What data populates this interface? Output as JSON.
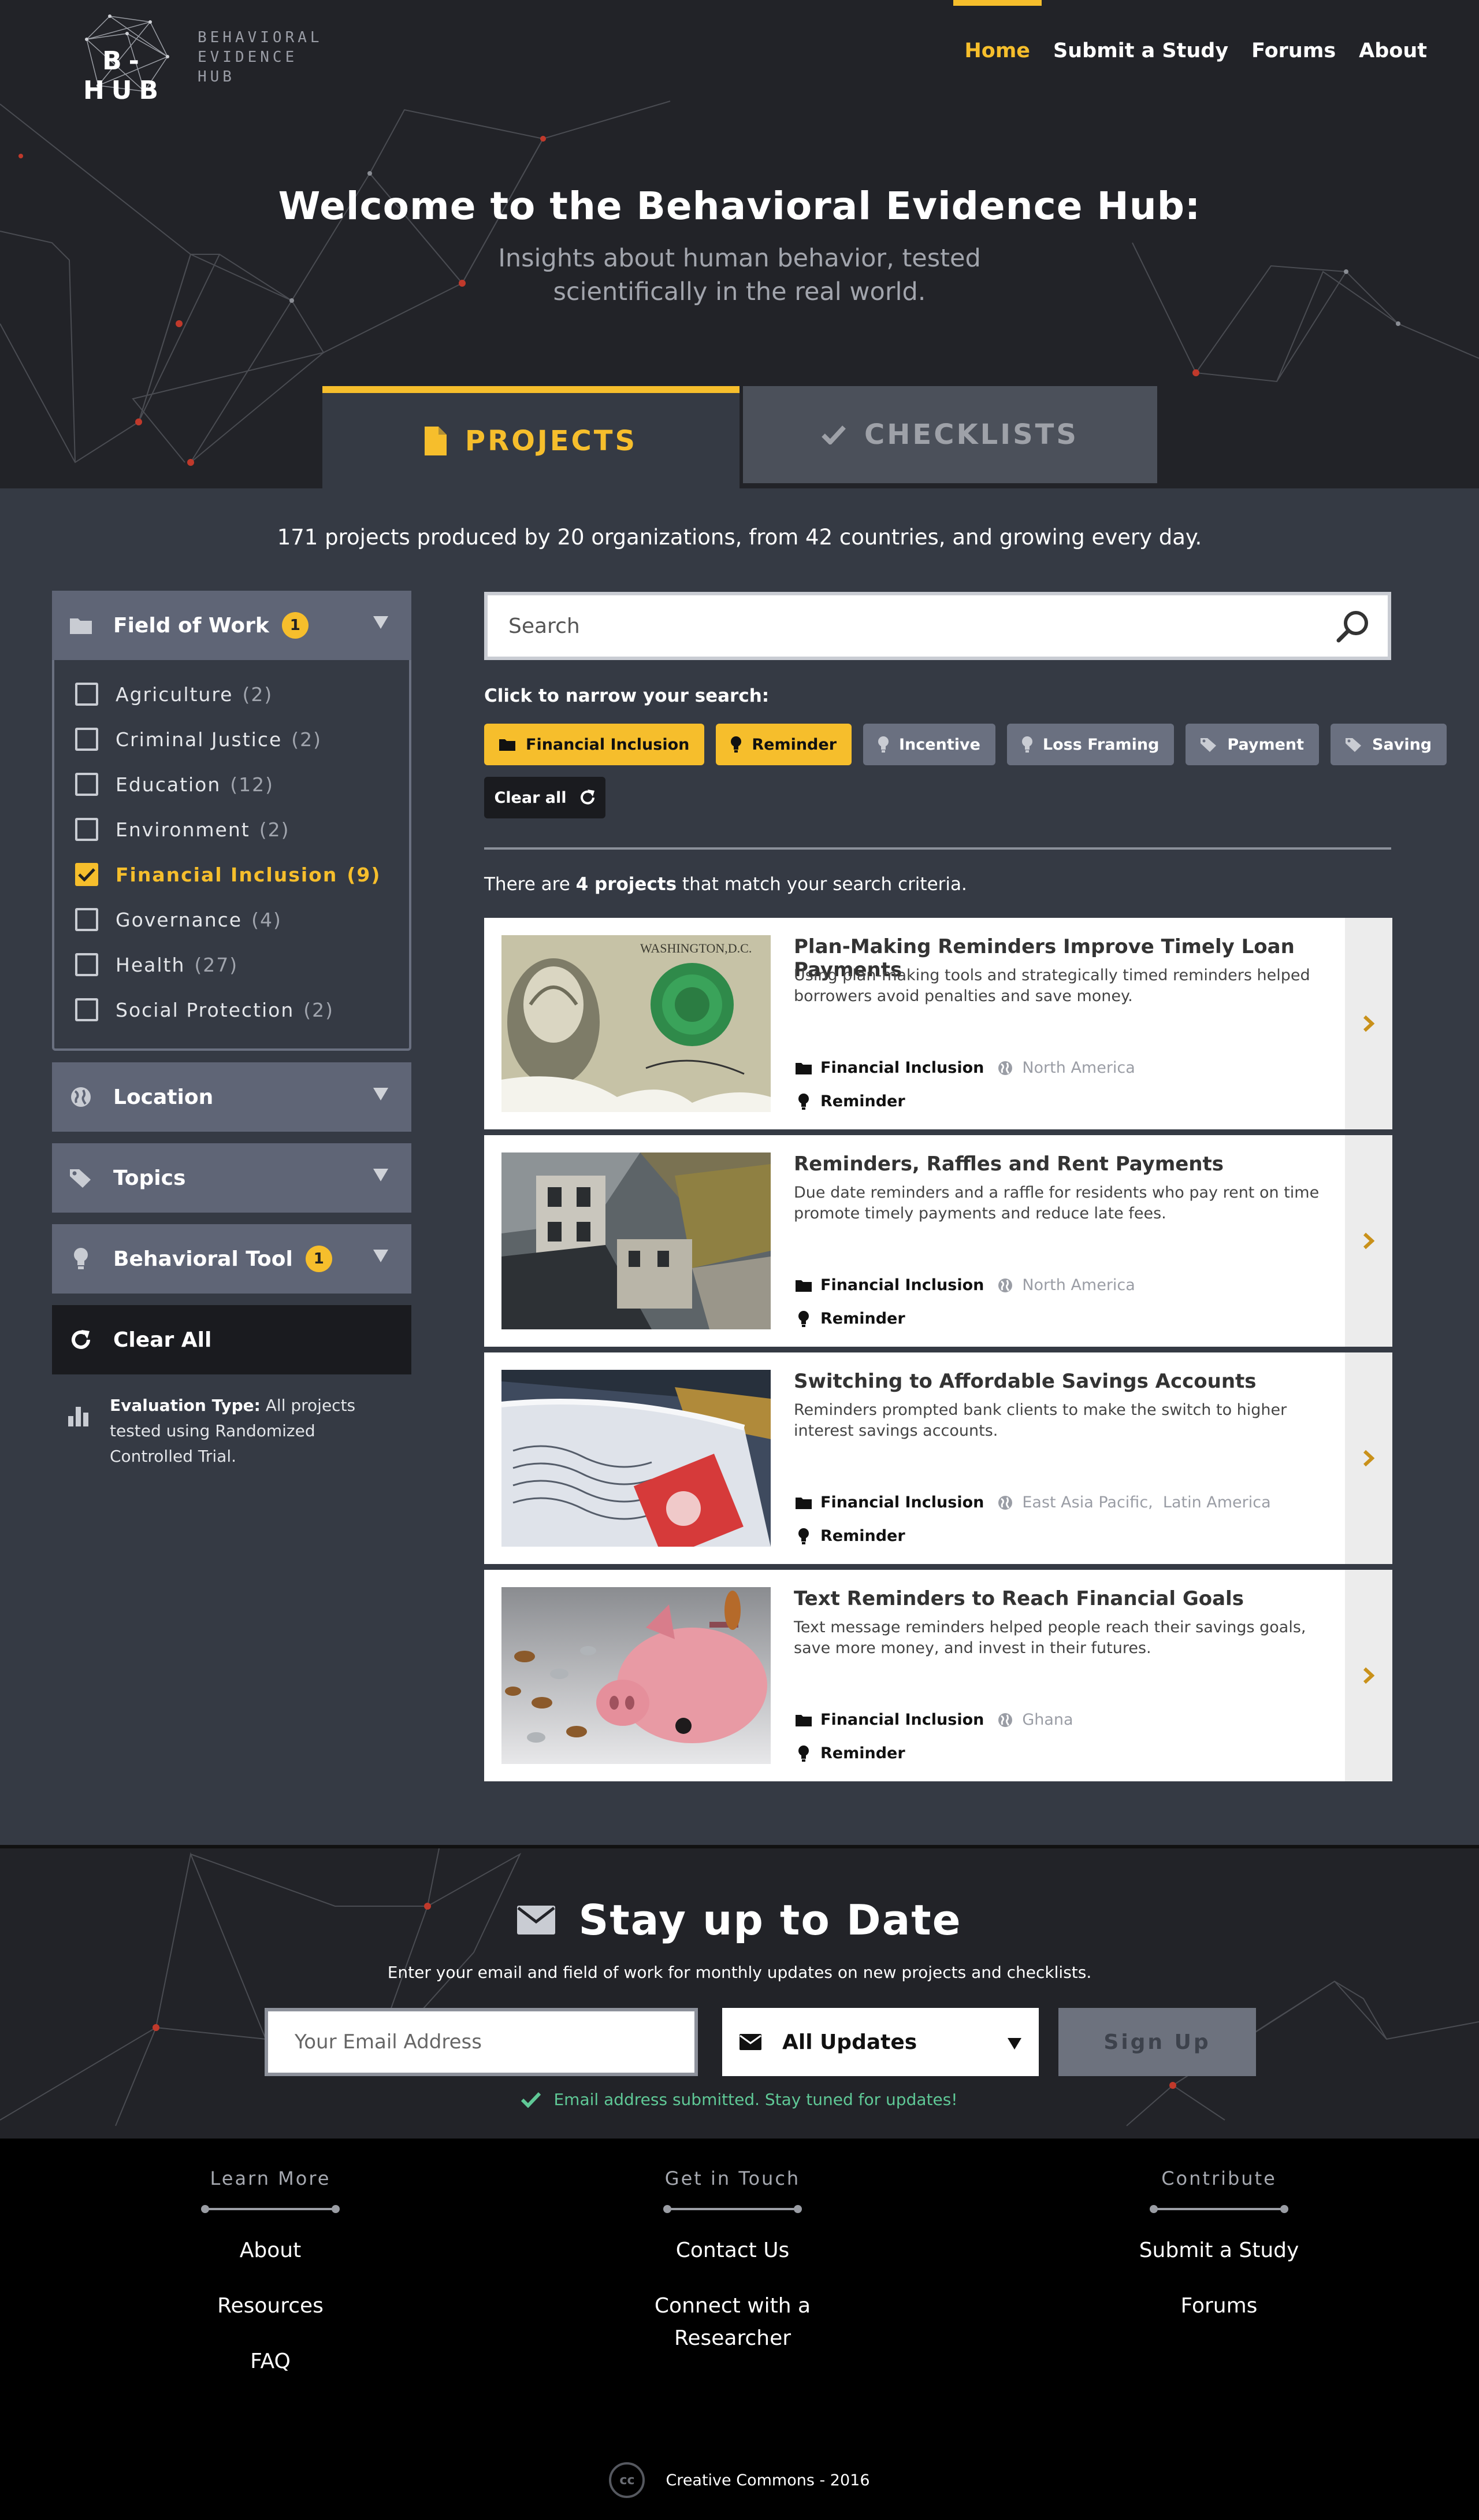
{
  "brand": {
    "short": "B-HUB",
    "full": [
      "BEHAVIORAL",
      "EVIDENCE",
      "HUB"
    ],
    "accent": "#f6be2c"
  },
  "nav": [
    {
      "label": "Home",
      "active": true
    },
    {
      "label": "Submit a Study",
      "active": false
    },
    {
      "label": "Forums",
      "active": false
    },
    {
      "label": "About",
      "active": false
    }
  ],
  "hero": {
    "title": "Welcome to the Behavioral Evidence Hub:",
    "tagline": "Insights about human behavior, tested scientifically in the real world."
  },
  "tabs": [
    {
      "label": "PROJECTS",
      "icon": "file-icon",
      "active": true
    },
    {
      "label": "CHECKLISTS",
      "icon": "check-icon",
      "active": false
    }
  ],
  "stats": "171 projects produced by 20 organizations, from 42 countries, and growing every day.",
  "sidebar": {
    "field_of_work": {
      "title": "Field of Work",
      "badge": "1",
      "items": [
        {
          "label": "Agriculture",
          "count": "(2)",
          "checked": false
        },
        {
          "label": "Criminal Justice",
          "count": "(2)",
          "checked": false
        },
        {
          "label": "Education",
          "count": "(12)",
          "checked": false
        },
        {
          "label": "Environment",
          "count": "(2)",
          "checked": false
        },
        {
          "label": "Financial Inclusion",
          "count": "(9)",
          "checked": true
        },
        {
          "label": "Governance",
          "count": "(4)",
          "checked": false
        },
        {
          "label": "Health",
          "count": "(27)",
          "checked": false
        },
        {
          "label": "Social Protection",
          "count": "(2)",
          "checked": false
        }
      ]
    },
    "location": {
      "title": "Location"
    },
    "topics": {
      "title": "Topics"
    },
    "behavioral_tool": {
      "title": "Behavioral Tool",
      "badge": "1"
    },
    "clear_all": "Clear All",
    "evaluation": {
      "label": "Evaluation Type:",
      "text": "All projects tested using Randomized Controlled Trial."
    }
  },
  "search": {
    "placeholder": "Search",
    "narrow_label": "Click to narrow your search:",
    "pills": [
      {
        "label": "Financial Inclusion",
        "icon": "folder-icon",
        "active": true
      },
      {
        "label": "Reminder",
        "icon": "lightbulb-icon",
        "active": true
      },
      {
        "label": "Incentive",
        "icon": "lightbulb-icon",
        "active": false
      },
      {
        "label": "Loss Framing",
        "icon": "lightbulb-icon",
        "active": false
      },
      {
        "label": "Payment",
        "icon": "tag-icon",
        "active": false
      },
      {
        "label": "Saving",
        "icon": "tag-icon",
        "active": false
      }
    ],
    "clear_all": "Clear all",
    "match_pre": "There are ",
    "match_count": "4 projects",
    "match_post": " that match your search criteria."
  },
  "projects": [
    {
      "title": "Plan-Making Reminders Improve Timely Loan Payments",
      "desc": "Using plan-making tools and strategically timed reminders helped borrowers avoid penalties and save money.",
      "field": "Financial Inclusion",
      "location": "North America",
      "tool": "Reminder",
      "image": "dollar-bill-image"
    },
    {
      "title": "Reminders, Raffles and Rent Payments",
      "desc": "Due date reminders and a raffle for residents who pay rent on time promote timely payments and reduce late fees.",
      "field": "Financial Inclusion",
      "location": "North America",
      "tool": "Reminder",
      "image": "rowhouses-image"
    },
    {
      "title": "Switching to Affordable Savings Accounts",
      "desc": "Reminders prompted bank clients to make the switch to higher interest savings accounts.",
      "field": "Financial Inclusion",
      "location": "East Asia Pacific,  Latin America",
      "tool": "Reminder",
      "image": "envelope-stamp-image"
    },
    {
      "title": "Text Reminders to Reach Financial Goals",
      "desc": "Text message reminders helped people reach their savings goals, save more money, and invest in their futures.",
      "field": "Financial Inclusion",
      "location": "Ghana",
      "tool": "Reminder",
      "image": "piggy-bank-image"
    }
  ],
  "newsletter": {
    "title": "Stay up to Date",
    "intro": "Enter your email and field of work for monthly updates on new projects and checklists.",
    "email_placeholder": "Your Email Address",
    "select_value": "All Updates",
    "button": "Sign Up",
    "success": "Email address submitted. Stay tuned for updates!"
  },
  "footer": {
    "columns": [
      {
        "heading": "Learn More",
        "links": [
          "About",
          "Resources",
          "FAQ"
        ]
      },
      {
        "heading": "Get in Touch",
        "links": [
          "Contact Us",
          "Connect with a Researcher"
        ]
      },
      {
        "heading": "Contribute",
        "links": [
          "Submit a Study",
          "Forums"
        ]
      }
    ],
    "cc_icon": "cc",
    "copyright": "Creative Commons - 2016"
  }
}
